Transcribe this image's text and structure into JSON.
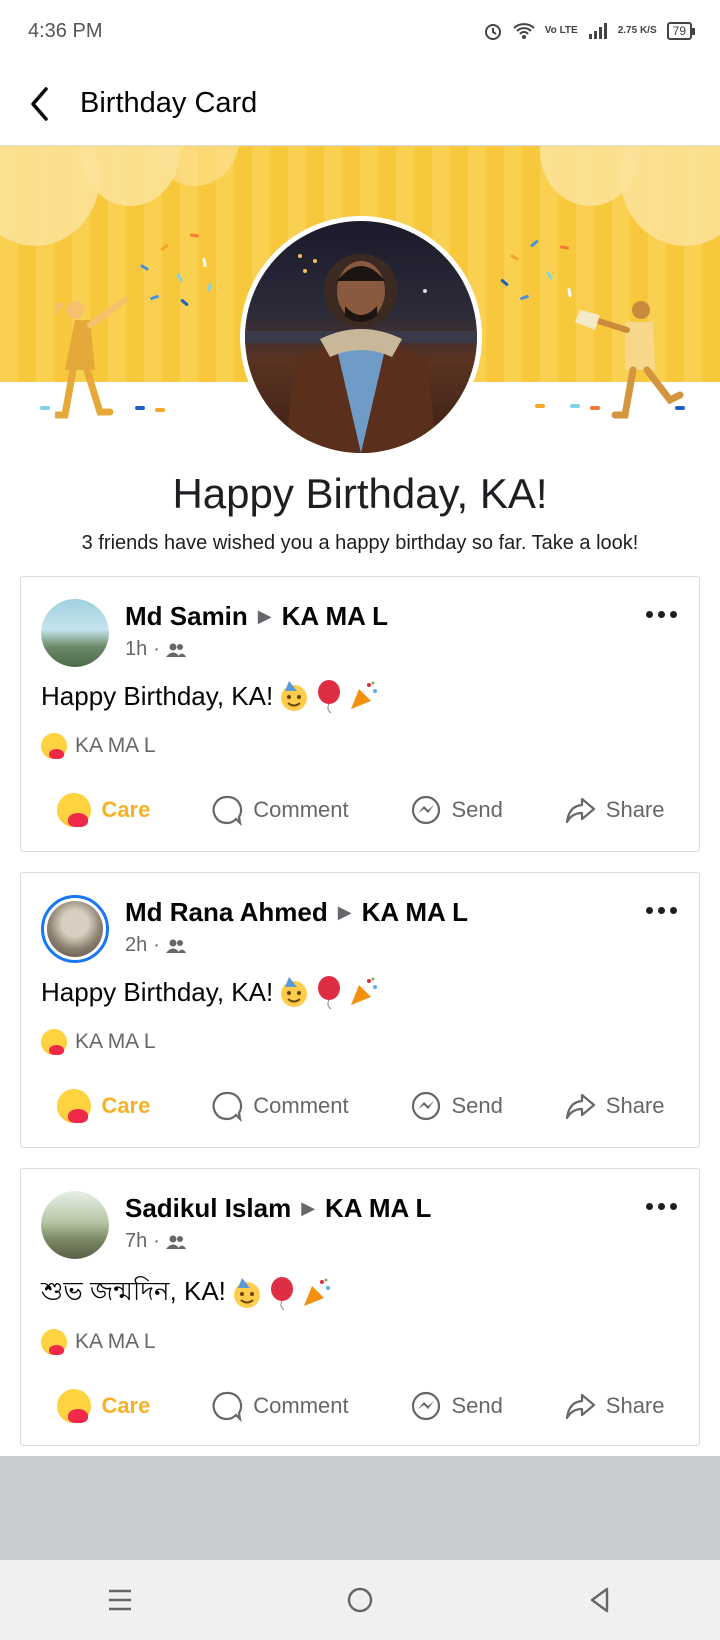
{
  "status_bar": {
    "time": "4:36 PM",
    "network": "Vo LTE",
    "speed": "2.75 K/S",
    "battery": "79"
  },
  "header": {
    "title": "Birthday Card",
    "back_icon": "chevron-left-icon"
  },
  "greeting": {
    "title": "Happy Birthday, KA!",
    "subtitle": "3 friends have wished you a happy birthday so far. Take a look!"
  },
  "colors": {
    "banner": "#f9d04f",
    "care": "#f7b125",
    "link_blue": "#1877f2",
    "muted": "#65676b"
  },
  "posts": [
    {
      "author": "Md Samin",
      "target": "KA MA L",
      "time": "1h",
      "text": "Happy Birthday, KA!",
      "reactor": "KA MA L",
      "actions": {
        "care": "Care",
        "comment": "Comment",
        "send": "Send",
        "share": "Share"
      }
    },
    {
      "author": "Md Rana Ahmed",
      "target": "KA MA L",
      "time": "2h",
      "text": "Happy Birthday, KA!",
      "reactor": "KA MA L",
      "actions": {
        "care": "Care",
        "comment": "Comment",
        "send": "Send",
        "share": "Share"
      }
    },
    {
      "author": "Sadikul Islam",
      "target": "KA MA L",
      "time": "7h",
      "text": "শুভ জন্মদিন, KA!",
      "reactor": "KA MA L",
      "actions": {
        "care": "Care",
        "comment": "Comment",
        "send": "Send",
        "share": "Share"
      }
    }
  ],
  "nav": {
    "menu_icon": "menu-icon",
    "home_icon": "home-circle-icon",
    "back_icon": "back-triangle-icon"
  }
}
